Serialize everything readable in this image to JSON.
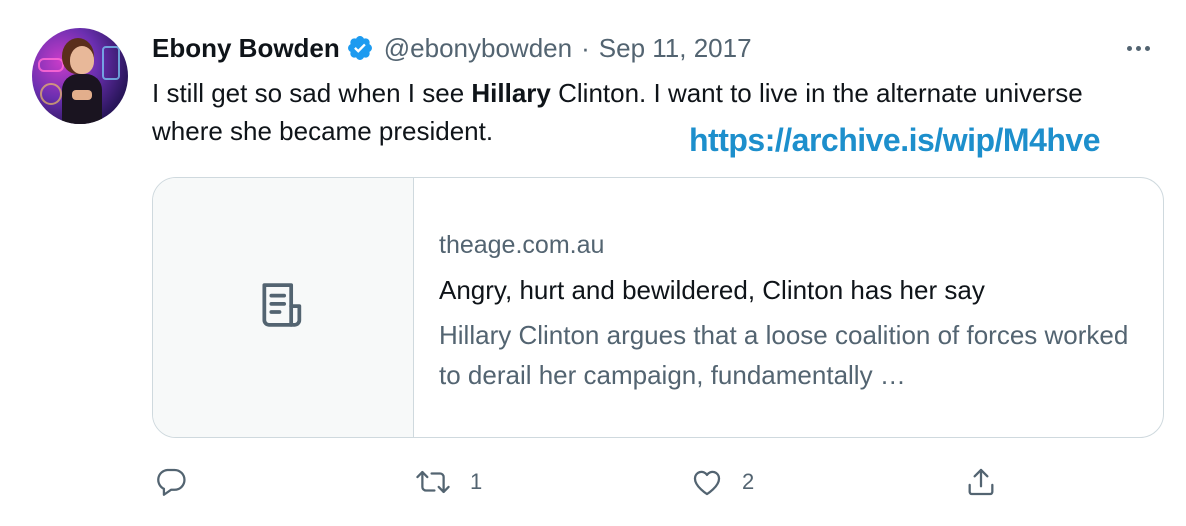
{
  "author": {
    "name": "Ebony Bowden",
    "handle": "@ebonybowden",
    "separator": "·",
    "date": "Sep 11, 2017"
  },
  "tweet": {
    "text_part1": "I still get so sad when I see ",
    "text_bold": "Hillary",
    "text_part2": " Clinton. I want to live in the alternate universe where she became president."
  },
  "overlay_link": "https://archive.is/wip/M4hve",
  "card": {
    "domain": "theage.com.au",
    "title": "Angry, hurt and bewildered, Clinton has her say",
    "description": "Hillary Clinton argues that a loose coalition of forces worked to derail her campaign, fundamentally …",
    "thumbnail_icon": "document-icon"
  },
  "actions": {
    "reply": {
      "icon": "reply-icon",
      "count": ""
    },
    "retweet": {
      "icon": "retweet-icon",
      "count": "1"
    },
    "like": {
      "icon": "heart-icon",
      "count": "2"
    },
    "share": {
      "icon": "share-icon",
      "count": ""
    }
  },
  "colors": {
    "verified": "#1d9bf0",
    "link": "#1d8fcc",
    "secondary_text": "#536471",
    "border": "#cfd9de"
  }
}
